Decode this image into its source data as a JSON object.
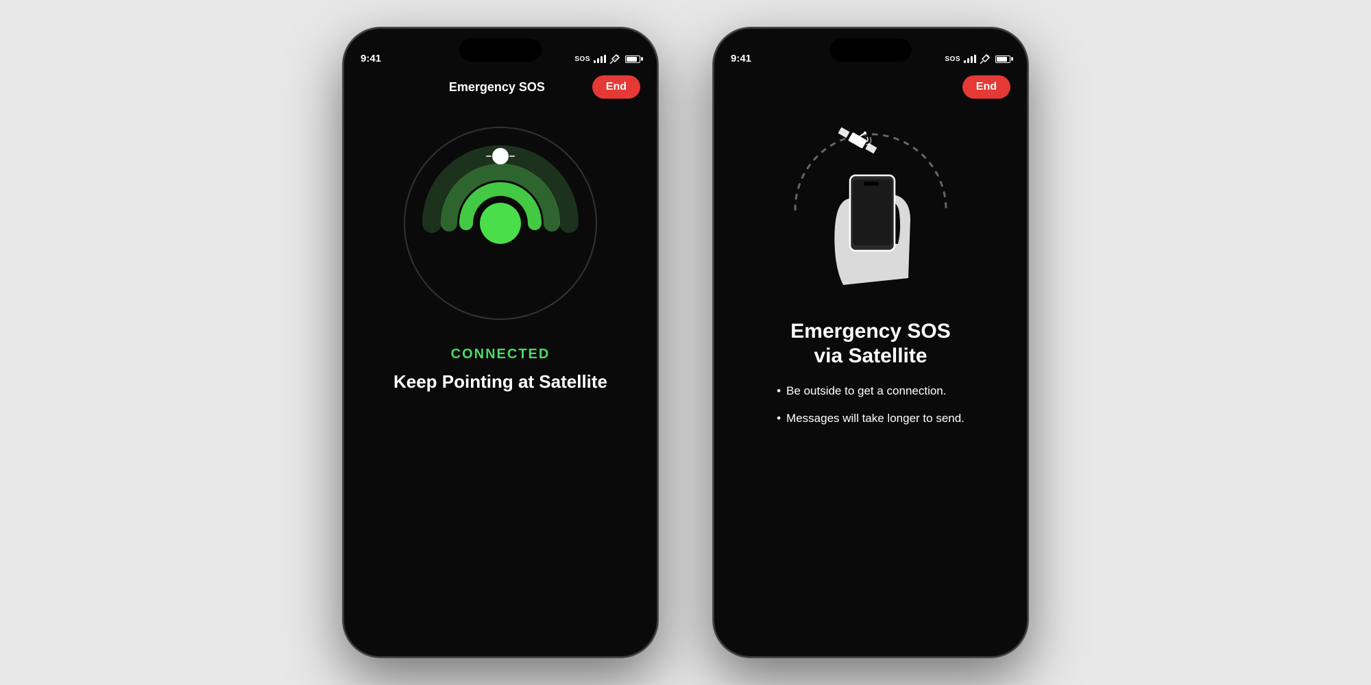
{
  "page": {
    "background": "#e8e8e8"
  },
  "phone1": {
    "status_time": "9:41",
    "status_sos": "SOS",
    "nav_title": "Emergency SOS",
    "end_button": "End",
    "connected_label": "CONNECTED",
    "instruction_text": "Keep Pointing at Satellite"
  },
  "phone2": {
    "status_time": "9:41",
    "status_sos": "SOS",
    "end_button": "End",
    "title_line1": "Emergency SOS",
    "title_line2": "via Satellite",
    "bullet1": "Be outside to get a connection.",
    "bullet2": "Messages will take longer to send."
  }
}
